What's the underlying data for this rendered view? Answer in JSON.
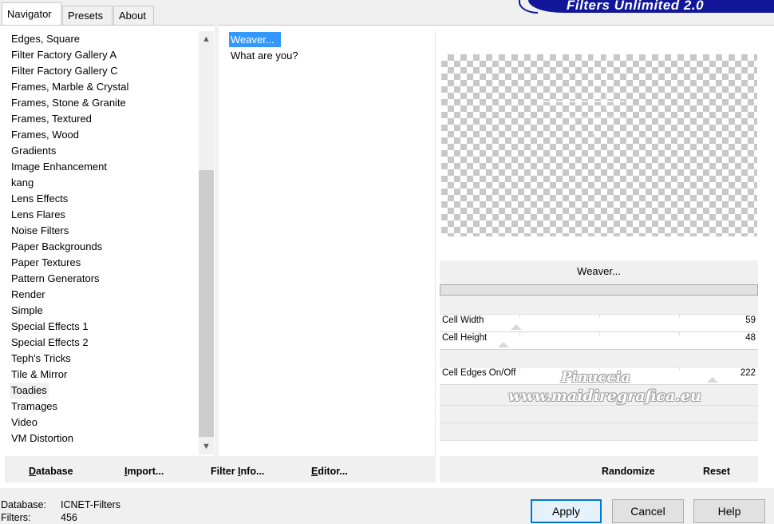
{
  "tabs": [
    {
      "label": "Navigator",
      "active": true
    },
    {
      "label": "Presets",
      "active": false
    },
    {
      "label": "About",
      "active": false
    }
  ],
  "logo_text": "Filters Unlimited 2.0",
  "categories": [
    "Edges, Square",
    "Filter Factory Gallery A",
    "Filter Factory Gallery C",
    "Frames, Marble & Crystal",
    "Frames, Stone & Granite",
    "Frames, Textured",
    "Frames, Wood",
    "Gradients",
    "Image Enhancement",
    "kang",
    "Lens Effects",
    "Lens Flares",
    "Noise Filters",
    "Paper Backgrounds",
    "Paper Textures",
    "Pattern Generators",
    "Render",
    "Simple",
    "Special Effects 1",
    "Special Effects 2",
    "Teph's Tricks",
    "Tile & Mirror",
    "Toadies",
    "Tramages",
    "Video",
    "VM Distortion"
  ],
  "selected_category": "Toadies",
  "filters": [
    "Weaver...",
    "What are you?"
  ],
  "selected_filter": "Weaver...",
  "filter_title": "Weaver...",
  "params": [
    {
      "label": "Cell Width",
      "value": "59",
      "level": 0.23
    },
    {
      "label": "Cell Height",
      "value": "48",
      "level": 0.19
    },
    {
      "label": "",
      "value": "",
      "level": null
    },
    {
      "label": "Cell Edges On/Off",
      "value": "222",
      "level": 0.87
    }
  ],
  "watermark": {
    "line1": "Pinuccia",
    "line2": "www.maidiregrafica.eu"
  },
  "left_buttons": [
    {
      "accel": "D",
      "rest": "atabase"
    },
    {
      "accel": "I",
      "rest": "mport..."
    },
    {
      "accel": "",
      "pre": "Filter ",
      "accel2": "I",
      "rest": "nfo..."
    },
    {
      "accel": "E",
      "rest": "ditor..."
    }
  ],
  "right_buttons": {
    "randomize": "Randomize",
    "reset": "Reset"
  },
  "status": {
    "database_label": "Database:",
    "database_value": "ICNET-Filters",
    "filters_label": "Filters:",
    "filters_value": "456"
  },
  "dialog_buttons": {
    "apply": "Apply",
    "cancel": "Cancel",
    "help": "Help"
  }
}
